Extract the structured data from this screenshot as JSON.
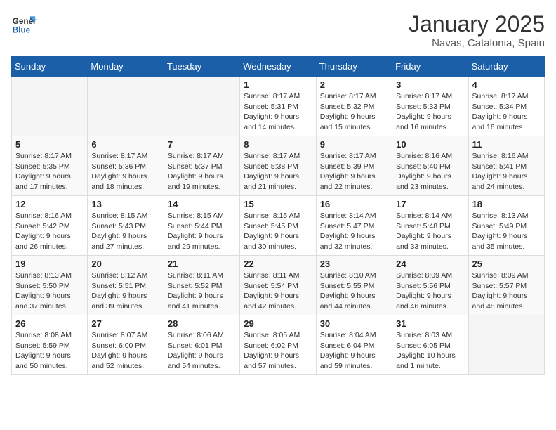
{
  "header": {
    "logo_general": "General",
    "logo_blue": "Blue",
    "title": "January 2025",
    "subtitle": "Navas, Catalonia, Spain"
  },
  "weekdays": [
    "Sunday",
    "Monday",
    "Tuesday",
    "Wednesday",
    "Thursday",
    "Friday",
    "Saturday"
  ],
  "weeks": [
    [
      {
        "day": "",
        "sunrise": "",
        "sunset": "",
        "daylight": ""
      },
      {
        "day": "",
        "sunrise": "",
        "sunset": "",
        "daylight": ""
      },
      {
        "day": "",
        "sunrise": "",
        "sunset": "",
        "daylight": ""
      },
      {
        "day": "1",
        "sunrise": "Sunrise: 8:17 AM",
        "sunset": "Sunset: 5:31 PM",
        "daylight": "Daylight: 9 hours and 14 minutes."
      },
      {
        "day": "2",
        "sunrise": "Sunrise: 8:17 AM",
        "sunset": "Sunset: 5:32 PM",
        "daylight": "Daylight: 9 hours and 15 minutes."
      },
      {
        "day": "3",
        "sunrise": "Sunrise: 8:17 AM",
        "sunset": "Sunset: 5:33 PM",
        "daylight": "Daylight: 9 hours and 16 minutes."
      },
      {
        "day": "4",
        "sunrise": "Sunrise: 8:17 AM",
        "sunset": "Sunset: 5:34 PM",
        "daylight": "Daylight: 9 hours and 16 minutes."
      }
    ],
    [
      {
        "day": "5",
        "sunrise": "Sunrise: 8:17 AM",
        "sunset": "Sunset: 5:35 PM",
        "daylight": "Daylight: 9 hours and 17 minutes."
      },
      {
        "day": "6",
        "sunrise": "Sunrise: 8:17 AM",
        "sunset": "Sunset: 5:36 PM",
        "daylight": "Daylight: 9 hours and 18 minutes."
      },
      {
        "day": "7",
        "sunrise": "Sunrise: 8:17 AM",
        "sunset": "Sunset: 5:37 PM",
        "daylight": "Daylight: 9 hours and 19 minutes."
      },
      {
        "day": "8",
        "sunrise": "Sunrise: 8:17 AM",
        "sunset": "Sunset: 5:38 PM",
        "daylight": "Daylight: 9 hours and 21 minutes."
      },
      {
        "day": "9",
        "sunrise": "Sunrise: 8:17 AM",
        "sunset": "Sunset: 5:39 PM",
        "daylight": "Daylight: 9 hours and 22 minutes."
      },
      {
        "day": "10",
        "sunrise": "Sunrise: 8:16 AM",
        "sunset": "Sunset: 5:40 PM",
        "daylight": "Daylight: 9 hours and 23 minutes."
      },
      {
        "day": "11",
        "sunrise": "Sunrise: 8:16 AM",
        "sunset": "Sunset: 5:41 PM",
        "daylight": "Daylight: 9 hours and 24 minutes."
      }
    ],
    [
      {
        "day": "12",
        "sunrise": "Sunrise: 8:16 AM",
        "sunset": "Sunset: 5:42 PM",
        "daylight": "Daylight: 9 hours and 26 minutes."
      },
      {
        "day": "13",
        "sunrise": "Sunrise: 8:15 AM",
        "sunset": "Sunset: 5:43 PM",
        "daylight": "Daylight: 9 hours and 27 minutes."
      },
      {
        "day": "14",
        "sunrise": "Sunrise: 8:15 AM",
        "sunset": "Sunset: 5:44 PM",
        "daylight": "Daylight: 9 hours and 29 minutes."
      },
      {
        "day": "15",
        "sunrise": "Sunrise: 8:15 AM",
        "sunset": "Sunset: 5:45 PM",
        "daylight": "Daylight: 9 hours and 30 minutes."
      },
      {
        "day": "16",
        "sunrise": "Sunrise: 8:14 AM",
        "sunset": "Sunset: 5:47 PM",
        "daylight": "Daylight: 9 hours and 32 minutes."
      },
      {
        "day": "17",
        "sunrise": "Sunrise: 8:14 AM",
        "sunset": "Sunset: 5:48 PM",
        "daylight": "Daylight: 9 hours and 33 minutes."
      },
      {
        "day": "18",
        "sunrise": "Sunrise: 8:13 AM",
        "sunset": "Sunset: 5:49 PM",
        "daylight": "Daylight: 9 hours and 35 minutes."
      }
    ],
    [
      {
        "day": "19",
        "sunrise": "Sunrise: 8:13 AM",
        "sunset": "Sunset: 5:50 PM",
        "daylight": "Daylight: 9 hours and 37 minutes."
      },
      {
        "day": "20",
        "sunrise": "Sunrise: 8:12 AM",
        "sunset": "Sunset: 5:51 PM",
        "daylight": "Daylight: 9 hours and 39 minutes."
      },
      {
        "day": "21",
        "sunrise": "Sunrise: 8:11 AM",
        "sunset": "Sunset: 5:52 PM",
        "daylight": "Daylight: 9 hours and 41 minutes."
      },
      {
        "day": "22",
        "sunrise": "Sunrise: 8:11 AM",
        "sunset": "Sunset: 5:54 PM",
        "daylight": "Daylight: 9 hours and 42 minutes."
      },
      {
        "day": "23",
        "sunrise": "Sunrise: 8:10 AM",
        "sunset": "Sunset: 5:55 PM",
        "daylight": "Daylight: 9 hours and 44 minutes."
      },
      {
        "day": "24",
        "sunrise": "Sunrise: 8:09 AM",
        "sunset": "Sunset: 5:56 PM",
        "daylight": "Daylight: 9 hours and 46 minutes."
      },
      {
        "day": "25",
        "sunrise": "Sunrise: 8:09 AM",
        "sunset": "Sunset: 5:57 PM",
        "daylight": "Daylight: 9 hours and 48 minutes."
      }
    ],
    [
      {
        "day": "26",
        "sunrise": "Sunrise: 8:08 AM",
        "sunset": "Sunset: 5:59 PM",
        "daylight": "Daylight: 9 hours and 50 minutes."
      },
      {
        "day": "27",
        "sunrise": "Sunrise: 8:07 AM",
        "sunset": "Sunset: 6:00 PM",
        "daylight": "Daylight: 9 hours and 52 minutes."
      },
      {
        "day": "28",
        "sunrise": "Sunrise: 8:06 AM",
        "sunset": "Sunset: 6:01 PM",
        "daylight": "Daylight: 9 hours and 54 minutes."
      },
      {
        "day": "29",
        "sunrise": "Sunrise: 8:05 AM",
        "sunset": "Sunset: 6:02 PM",
        "daylight": "Daylight: 9 hours and 57 minutes."
      },
      {
        "day": "30",
        "sunrise": "Sunrise: 8:04 AM",
        "sunset": "Sunset: 6:04 PM",
        "daylight": "Daylight: 9 hours and 59 minutes."
      },
      {
        "day": "31",
        "sunrise": "Sunrise: 8:03 AM",
        "sunset": "Sunset: 6:05 PM",
        "daylight": "Daylight: 10 hours and 1 minute."
      },
      {
        "day": "",
        "sunrise": "",
        "sunset": "",
        "daylight": ""
      }
    ]
  ]
}
